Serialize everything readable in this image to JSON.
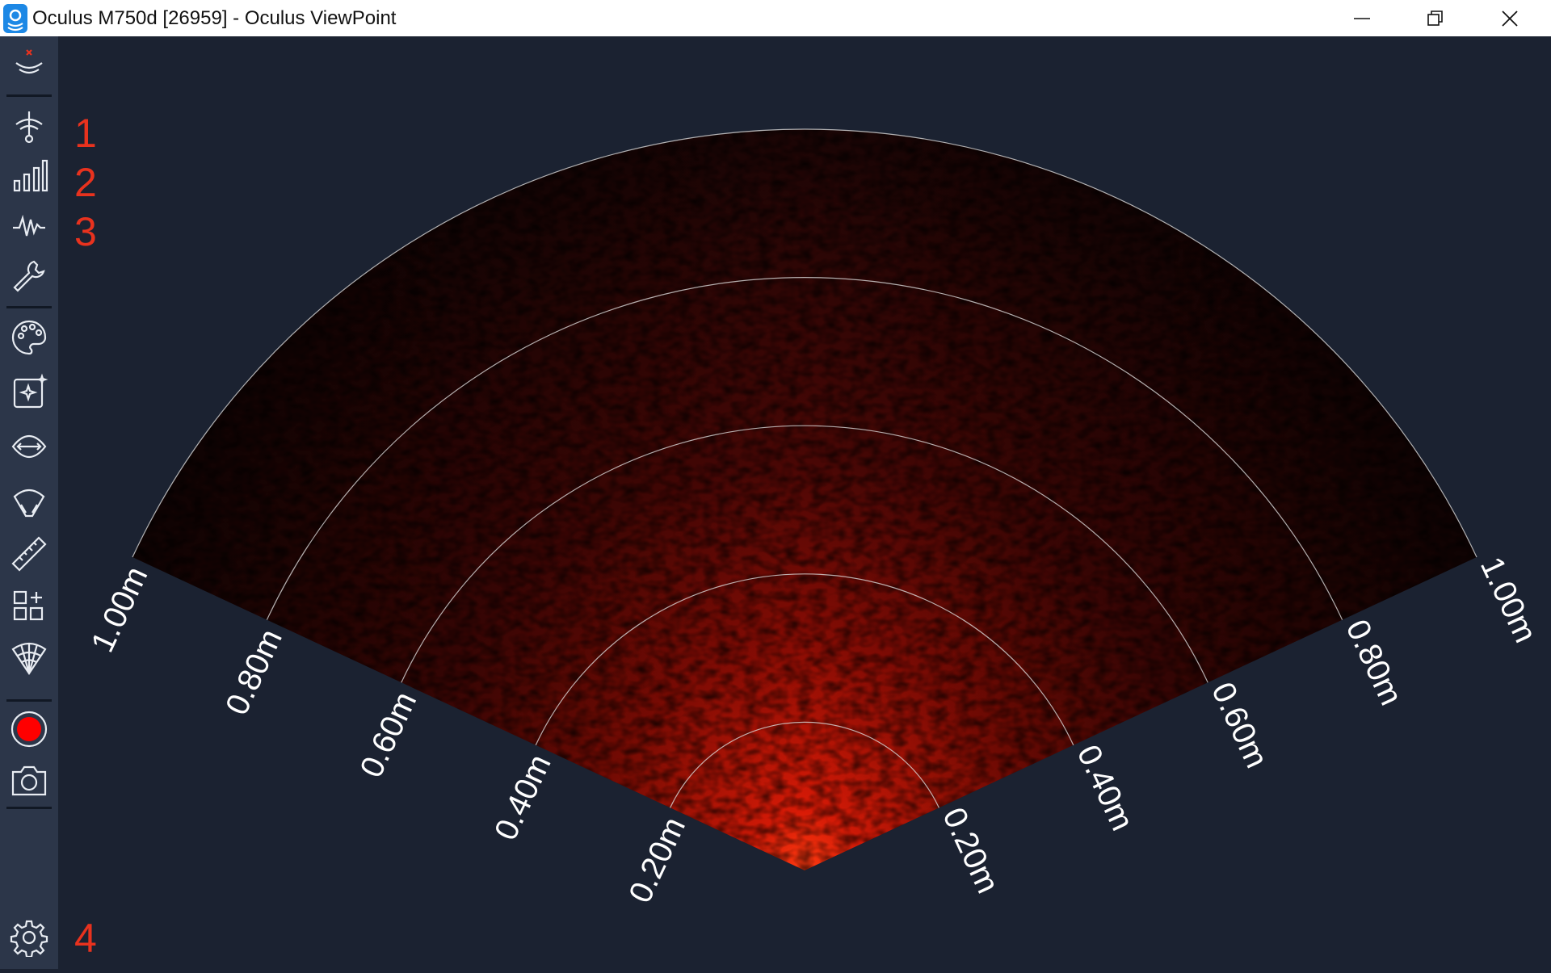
{
  "window": {
    "title": "Oculus M750d [26959] - Oculus ViewPoint",
    "controls": [
      "minimize-icon",
      "restore-icon",
      "close-icon"
    ]
  },
  "sidebar": {
    "tools": [
      {
        "name": "sonar-disconnected-icon"
      },
      {
        "name": "sonar-settings-icon"
      },
      {
        "name": "gain-bars-icon"
      },
      {
        "name": "waveform-icon"
      },
      {
        "name": "wrench-icon"
      },
      {
        "name": "palette-icon"
      },
      {
        "name": "image-enhance-icon"
      },
      {
        "name": "rotate-view-icon"
      },
      {
        "name": "flip-view-icon"
      },
      {
        "name": "ruler-icon"
      },
      {
        "name": "layout-grid-icon"
      },
      {
        "name": "fan-view-icon"
      },
      {
        "name": "record-button-icon"
      },
      {
        "name": "camera-snapshot-icon"
      },
      {
        "name": "settings-gear-icon"
      }
    ],
    "markers": [
      "1",
      "2",
      "3",
      "4"
    ]
  },
  "sonar_view": {
    "range_labels_left": [
      "1.00m",
      "0.80m",
      "0.60m",
      "0.40m",
      "0.20m"
    ],
    "range_labels_right": [
      "1.00m",
      "0.80m",
      "0.60m",
      "0.40m",
      "0.20m"
    ],
    "max_range_m": 1.0,
    "ring_ranges_m": [
      0.2,
      0.4,
      0.6,
      0.8,
      1.0
    ],
    "colors": {
      "background": "#1b2231",
      "sidebar": "#2c3649",
      "sonar_dark": "#1a0505",
      "sonar_bright": "#ff2a00",
      "marker": "#e8321e",
      "record": "#ff0000"
    }
  }
}
